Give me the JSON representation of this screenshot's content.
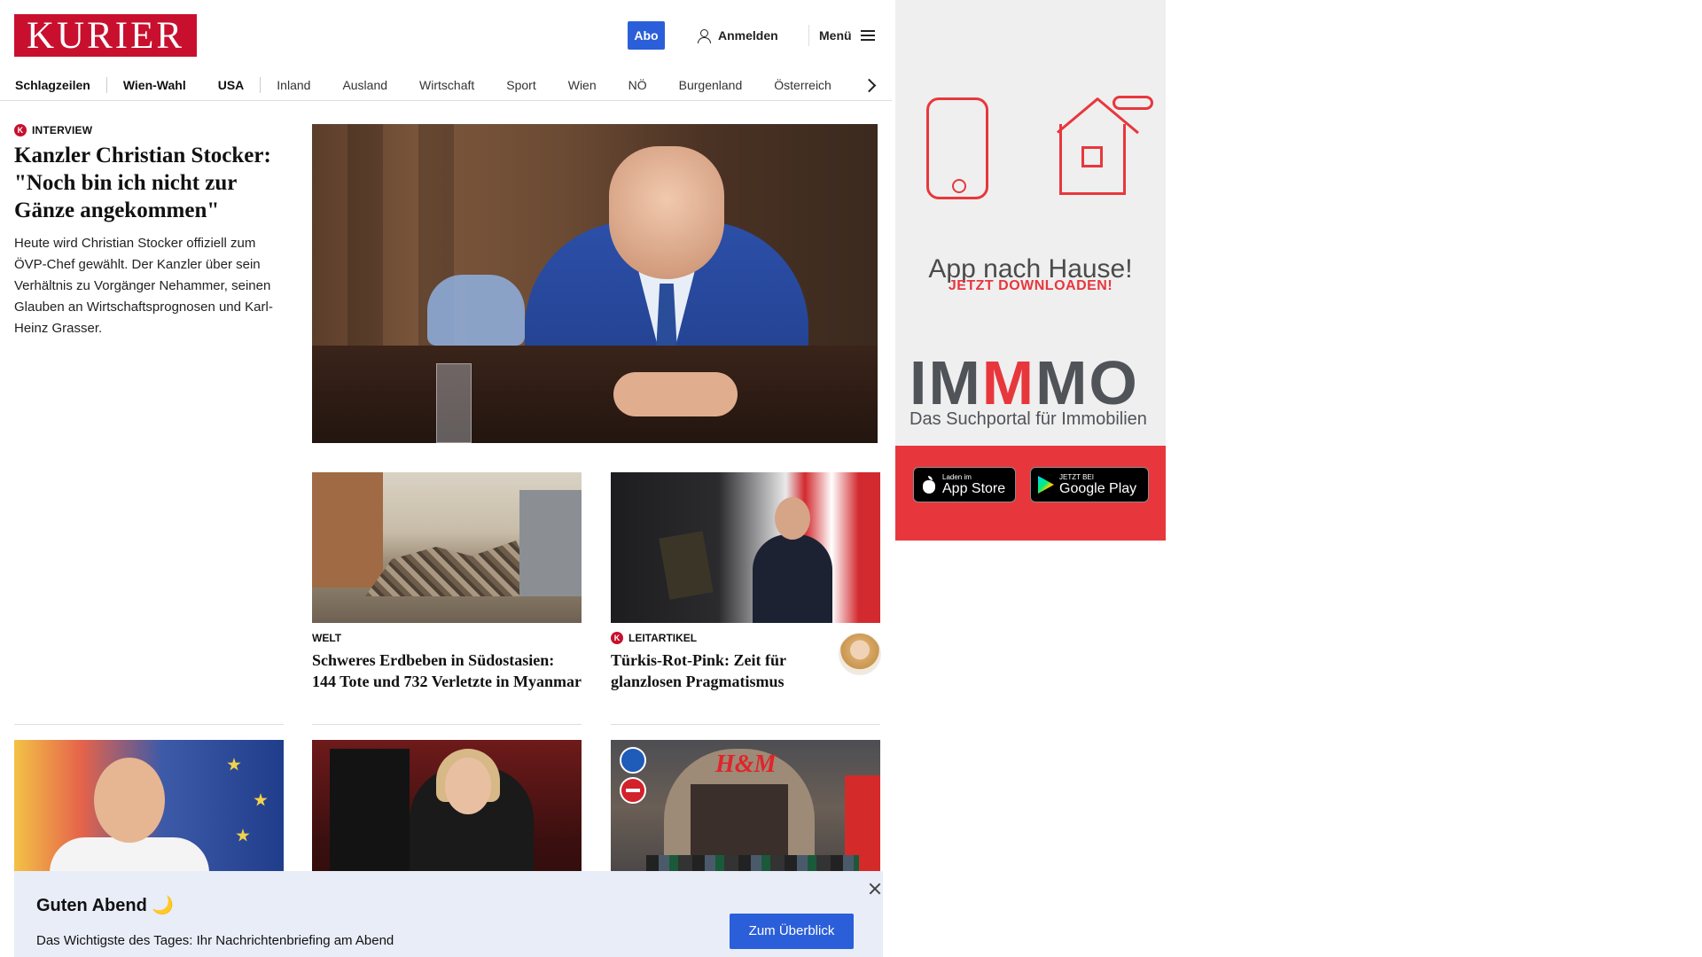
{
  "header": {
    "logo": "KURIER",
    "abo_label": "Abo",
    "login_label": "Anmelden",
    "menu_label": "Menü"
  },
  "nav": {
    "items": [
      "Schlagzeilen",
      "Wien-Wahl",
      "USA",
      "Inland",
      "Ausland",
      "Wirtschaft",
      "Sport",
      "Wien",
      "NÖ",
      "Burgenland",
      "Österreich"
    ]
  },
  "lead": {
    "kicker": "INTERVIEW",
    "title": "Kanzler Christian Stocker: \"Noch bin ich nicht zur Gänze angekommen\"",
    "description": "Heute wird Christian Stocker offiziell zum ÖVP-Chef gewählt. Der Kanzler über sein Verhältnis zu Vorgänger Nehammer, seinen Glauben an Wirtschaftsprognosen und Karl-Heinz Grasser."
  },
  "cards": [
    {
      "kicker": "WELT",
      "title": "Schweres Erdbeben in Südostasien: 144 Tote und 732 Verletzte in Myanmar"
    },
    {
      "kicker": "LEITARTIKEL",
      "title": "Türkis-Rot-Pink: Zeit für glanzlosen Pragmatismus"
    }
  ],
  "briefing": {
    "title": "Guten Abend 🌙",
    "description": "Das Wichtigste des Tages: Ihr Nachrichtenbriefing am Abend",
    "button_label": "Zum Überblick"
  },
  "ad": {
    "headline": "App nach Hause!",
    "subline": "JETZT DOWNLOADEN!",
    "brand_prefix": "IM",
    "brand_accent": "M",
    "brand_suffix": "MO",
    "brand_tagline": "Das Suchportal für Immobilien",
    "appstore_small": "Laden im",
    "appstore_big": "App Store",
    "googleplay_small": "JETZT BEI",
    "googleplay_big": "Google Play"
  },
  "colors": {
    "brand_red": "#c8102e",
    "accent_blue": "#2b5fd9",
    "ad_red": "#e8373c",
    "briefing_bg": "#e8edf7"
  }
}
